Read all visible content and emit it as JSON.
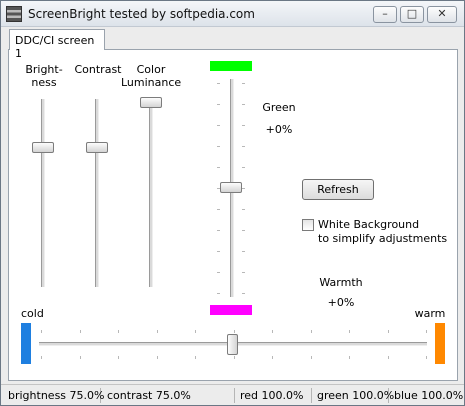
{
  "window": {
    "title": "ScreenBright tested by softpedia.com"
  },
  "titlebar_buttons": {
    "minimize": "–",
    "maximize": "□",
    "close": "✕"
  },
  "tabs": [
    {
      "label": "DDC/CI screen 1",
      "active": true
    }
  ],
  "sliders": {
    "brightness": {
      "label": "Bright-\nness",
      "value_percent": 75.0
    },
    "contrast": {
      "label": "Contrast",
      "value_percent": 75.0
    },
    "color_luminance": {
      "label": "Color\nLuminance",
      "value_percent": 100.0
    },
    "green": {
      "label": "Green",
      "value_text": "+0%",
      "swatch_color": "#00ff00"
    },
    "warmth": {
      "label": "Warmth",
      "value_text": "+0%",
      "cold_label": "cold",
      "warm_label": "warm",
      "cold_color": "#1e7fe0",
      "warm_color": "#ff8800",
      "magenta_color": "#ff00ff"
    }
  },
  "buttons": {
    "refresh": "Refresh"
  },
  "checkbox": {
    "label_line1": "White Background",
    "label_line2": "to simplify adjustments",
    "checked": false
  },
  "statusbar": {
    "brightness": "brightness 75.0%",
    "contrast": "contrast 75.0%",
    "red": "red 100.0%",
    "green": "green 100.0%",
    "blue": "blue 100.0%"
  }
}
